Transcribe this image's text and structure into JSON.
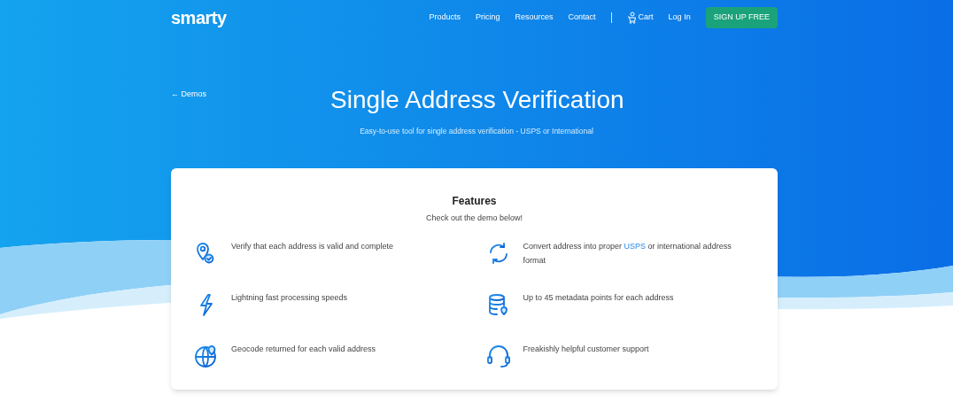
{
  "nav": {
    "logo": "smarty",
    "links": [
      "Products",
      "Pricing",
      "Resources",
      "Contact"
    ],
    "cart": "Cart",
    "login": "Log In",
    "signup": "SIGN UP FREE"
  },
  "back_link": "← Demos",
  "hero": {
    "title": "Single Address Verification",
    "subtitle": "Easy-to-use tool for single address verification - USPS or International"
  },
  "card": {
    "title": "Features",
    "subtitle": "Check out the demo below!",
    "features": [
      {
        "segments": [
          {
            "text": "Verify that each address is valid and complete"
          }
        ]
      },
      {
        "segments": [
          {
            "text": "Convert address into proper "
          },
          {
            "text": "USPS",
            "kind": "link"
          },
          {
            "text": " or international address format"
          }
        ]
      },
      {
        "segments": [
          {
            "text": "Lightning fast processing speeds"
          }
        ]
      },
      {
        "segments": [
          {
            "text": "Up to 45 metadata points for each address"
          }
        ]
      },
      {
        "segments": [
          {
            "text": "Geocode returned for each valid address"
          }
        ]
      },
      {
        "segments": [
          {
            "text": "Freakishly helpful customer support"
          }
        ]
      }
    ]
  }
}
